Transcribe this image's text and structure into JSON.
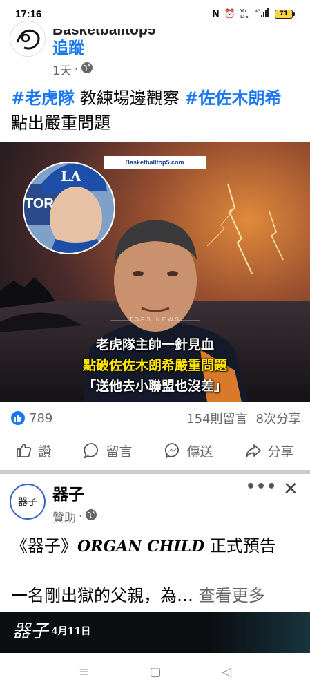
{
  "status_bar": {
    "time": "17:16",
    "icons": [
      "nfc-icon",
      "alarm-icon",
      "volte-icon",
      "signal-icon"
    ],
    "volte_text": "Vo LTE",
    "network_text": "4G",
    "battery": "71"
  },
  "post1": {
    "page_name": "Basketballtop5",
    "follow_label": "追蹤",
    "time_ago": "1天",
    "privacy_icon": "globe-icon",
    "text_segments": [
      {
        "type": "hashtag",
        "text": "#老虎隊"
      },
      {
        "type": "text",
        "text": " 教練場邊觀察 "
      },
      {
        "type": "hashtag",
        "text": "#佐佐木朗希"
      },
      {
        "type": "text",
        "text": " 點出嚴重問題"
      }
    ],
    "image": {
      "watermark": "Basketballtop5.com",
      "news_tag": "TOPS NEWS",
      "caption_line1": "老虎隊主帥一針見血",
      "caption_line2": "點破佐佐木朗希嚴重問題",
      "caption_line3": "「送他去小聯盟也沒差」",
      "caption_highlight_color": "#ffe600"
    },
    "reactions_count": "789",
    "comments": "154則留言",
    "shares": "8次分享",
    "actions": {
      "like": "讚",
      "comment": "留言",
      "send": "傳送",
      "share": "分享"
    }
  },
  "post2": {
    "page_name": "器子",
    "avatar_text": "器子",
    "sponsored": "贊助",
    "title_prefix": "《器子》",
    "title_en": "ORGAN CHILD",
    "title_suffix": " 正式預告",
    "body": "一名剛出獄的父親，為… ",
    "see_more": "查看更多",
    "video_logo": "器子",
    "video_date": "4月11日"
  },
  "nav": {
    "menu_icon": "≡",
    "home_icon": "▢",
    "back_icon": "◁"
  },
  "colors": {
    "accent": "#1877f2",
    "secondary_text": "#65676b"
  }
}
